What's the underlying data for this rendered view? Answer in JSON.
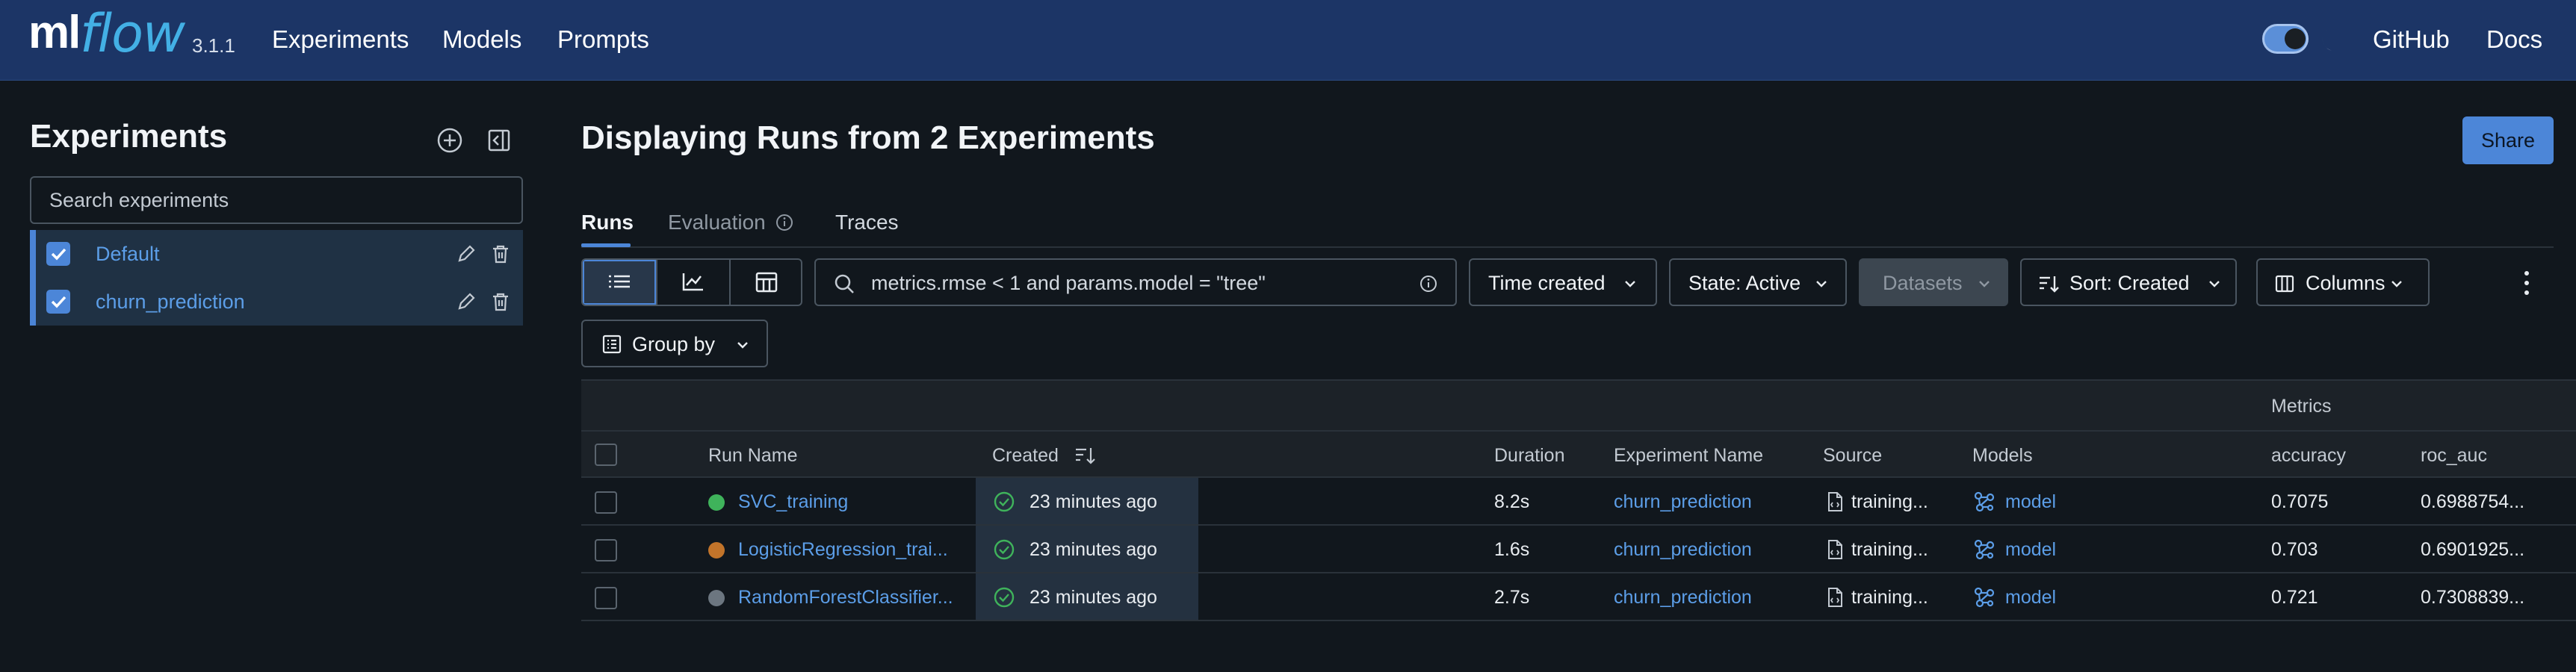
{
  "brand": {
    "logo_ml": "ml",
    "logo_flow": "flow",
    "version": "3.1.1"
  },
  "nav": {
    "experiments": "Experiments",
    "models": "Models",
    "prompts": "Prompts",
    "github": "GitHub",
    "docs": "Docs"
  },
  "sidebar": {
    "title": "Experiments",
    "search_placeholder": "Search experiments",
    "experiments": [
      {
        "name": "Default",
        "checked": true
      },
      {
        "name": "churn_prediction",
        "checked": true
      }
    ]
  },
  "main": {
    "title": "Displaying Runs from 2 Experiments",
    "share_label": "Share",
    "tabs": {
      "runs": "Runs",
      "evaluation": "Evaluation",
      "traces": "Traces"
    },
    "filter_placeholder": "metrics.rmse < 1 and params.model = \"tree\"",
    "controls": {
      "time_created": "Time created",
      "state": "State: Active",
      "datasets": "Datasets",
      "sort": "Sort: Created",
      "columns": "Columns",
      "group_by": "Group by"
    }
  },
  "table": {
    "group_header_metrics": "Metrics",
    "columns": {
      "run_name": "Run Name",
      "created": "Created",
      "duration": "Duration",
      "experiment_name": "Experiment Name",
      "source": "Source",
      "models": "Models",
      "accuracy": "accuracy",
      "roc_auc": "roc_auc"
    },
    "rows": [
      {
        "run_name": "SVC_training",
        "status_color": "#3fb35b",
        "created": "23 minutes ago",
        "duration": "8.2s",
        "experiment": "churn_prediction",
        "source": "training...",
        "model": "model",
        "accuracy": "0.7075",
        "roc_auc": "0.6988754..."
      },
      {
        "run_name": "LogisticRegression_trai...",
        "status_color": "#c2742a",
        "created": "23 minutes ago",
        "duration": "1.6s",
        "experiment": "churn_prediction",
        "source": "training...",
        "model": "model",
        "accuracy": "0.703",
        "roc_auc": "0.6901925..."
      },
      {
        "run_name": "RandomForestClassifier...",
        "status_color": "#6c7680",
        "created": "23 minutes ago",
        "duration": "2.7s",
        "experiment": "churn_prediction",
        "source": "training...",
        "model": "model",
        "accuracy": "0.721",
        "roc_auc": "0.7308839..."
      }
    ]
  },
  "colors": {
    "topbar": "#1c3566",
    "accent": "#4c86d8",
    "link": "#5c9ee8",
    "background": "#11171d"
  }
}
